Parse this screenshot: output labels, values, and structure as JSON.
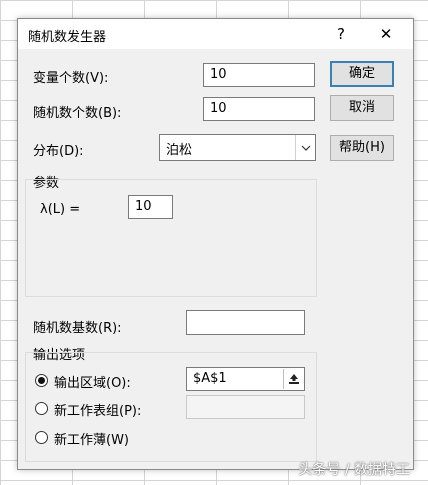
{
  "window": {
    "title": "随机数发生器",
    "help_glyph": "?",
    "close_glyph": "✕"
  },
  "fields": {
    "num_variables_label": "变量个数(V):",
    "num_variables_value": "10",
    "num_random_label": "随机数个数(B):",
    "num_random_value": "10",
    "distribution_label": "分布(D):",
    "distribution_value": "泊松"
  },
  "buttons": {
    "ok": "确定",
    "cancel": "取消",
    "help": "帮助(H)"
  },
  "params": {
    "group_label": "参数",
    "lambda_label": "λ(L) =",
    "lambda_value": "10"
  },
  "seed": {
    "label": "随机数基数(R):",
    "value": ""
  },
  "output": {
    "group_label": "输出选项",
    "range_label": "输出区域(O):",
    "range_value": "$A$1",
    "new_sheet_label": "新工作表组(P):",
    "new_sheet_value": "",
    "new_workbook_label": "新工作薄(W)"
  },
  "watermark": "头条号 / 数据特工"
}
